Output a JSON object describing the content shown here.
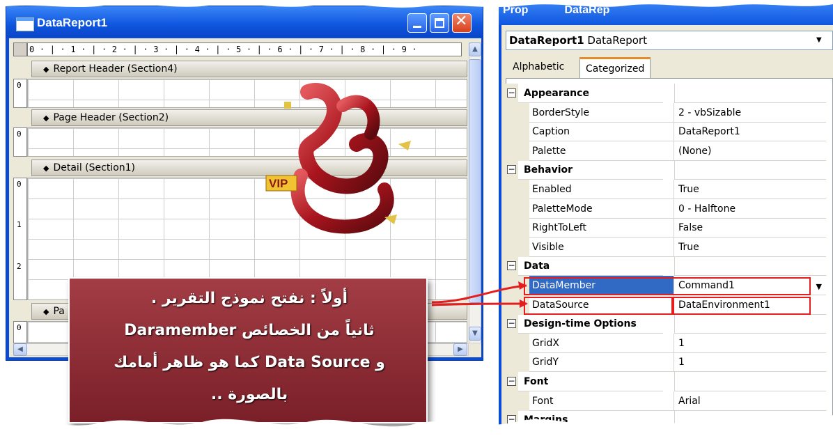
{
  "report_window": {
    "title": "DataReport1",
    "ruler_text": "0 · | · 1 · | · 2 · | · 3 · | · 4 · | · 5 · | · 6 · | · 7 · | · 8 · | · 9 ·",
    "sections": [
      {
        "label": "Report Header (Section4)"
      },
      {
        "label": "Page Header (Section2)"
      },
      {
        "label": "Detail (Section1)"
      },
      {
        "label": "Pa"
      }
    ],
    "vruler_labels": [
      "0",
      "0",
      "0",
      "1",
      "2",
      "0"
    ],
    "logo_badge": "VIP"
  },
  "properties_window": {
    "title_left": "Prop",
    "title_right": "DataRep",
    "object_name": "DataReport1",
    "object_type": "DataReport",
    "tabs": [
      {
        "label": "Alphabetic"
      },
      {
        "label": "Categorized"
      }
    ],
    "rows": [
      {
        "kind": "category",
        "name": "Appearance",
        "value": ""
      },
      {
        "kind": "prop",
        "name": "BorderStyle",
        "value": "2 - vbSizable"
      },
      {
        "kind": "prop",
        "name": "Caption",
        "value": "DataReport1"
      },
      {
        "kind": "prop",
        "name": "Palette",
        "value": "(None)"
      },
      {
        "kind": "category",
        "name": "Behavior",
        "value": ""
      },
      {
        "kind": "prop",
        "name": "Enabled",
        "value": "True"
      },
      {
        "kind": "prop",
        "name": "PaletteMode",
        "value": "0 - Halftone"
      },
      {
        "kind": "prop",
        "name": "RightToLeft",
        "value": "False"
      },
      {
        "kind": "prop",
        "name": "Visible",
        "value": "True"
      },
      {
        "kind": "category",
        "name": "Data",
        "value": ""
      },
      {
        "kind": "prop",
        "name": "DataMember",
        "value": "Command1",
        "selected": true
      },
      {
        "kind": "prop",
        "name": "DataSource",
        "value": "DataEnvironment1"
      },
      {
        "kind": "category",
        "name": "Design-time Options",
        "value": ""
      },
      {
        "kind": "prop",
        "name": "GridX",
        "value": "1"
      },
      {
        "kind": "prop",
        "name": "GridY",
        "value": "1"
      },
      {
        "kind": "category",
        "name": "Font",
        "value": ""
      },
      {
        "kind": "prop",
        "name": "Font",
        "value": "Arial"
      },
      {
        "kind": "category",
        "name": "Margins",
        "value": ""
      }
    ]
  },
  "callout": {
    "line1": "أولاً : نفتح نموذج التقرير .",
    "line2": "ثانياً من الخصائص Daramember",
    "line3": "و Data Source كما هو ظاهر أمامك",
    "line4": "بالصورة .."
  },
  "colors": {
    "xp_blue": "#0a4cd6",
    "selection": "#316ac5",
    "highlight_box": "#e51d1d",
    "callout_bg": "#8b2a33"
  }
}
